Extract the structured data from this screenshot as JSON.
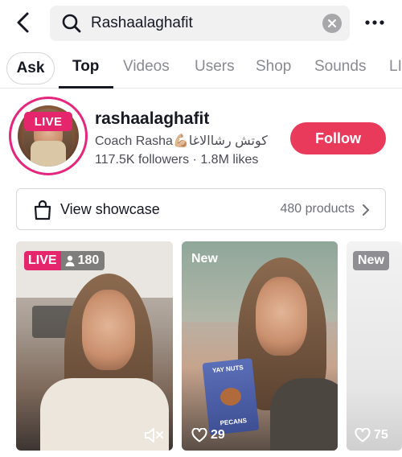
{
  "search": {
    "query": "Rashaalaghafit"
  },
  "tabs": [
    {
      "label": "Ask"
    },
    {
      "label": "Top"
    },
    {
      "label": "Videos"
    },
    {
      "label": "Users"
    },
    {
      "label": "Shop"
    },
    {
      "label": "Sounds"
    },
    {
      "label": "LI"
    }
  ],
  "active_tab": "Top",
  "profile": {
    "live_badge": "LIVE",
    "username": "rashaalaghafit",
    "subtitle": "Coach Rasha💪🏼كوتش رشاالاغا",
    "stats": "117.5K followers · 1.8M likes",
    "follow_label": "Follow"
  },
  "showcase": {
    "label": "View showcase",
    "count": "480 products"
  },
  "videos": [
    {
      "live_label": "LIVE",
      "viewers": "180"
    },
    {
      "badge": "New",
      "likes": "29"
    },
    {
      "badge": "New",
      "likes": "75"
    }
  ],
  "colors": {
    "accent": "#ea3a5c",
    "live": "#e5266d",
    "ring": "#e5267c"
  }
}
